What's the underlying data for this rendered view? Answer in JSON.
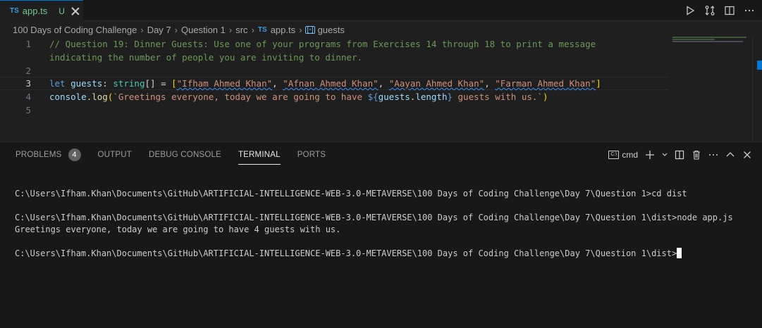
{
  "tab": {
    "lang": "TS",
    "filename": "app.ts",
    "status": "U"
  },
  "breadcrumb": {
    "items": [
      "100 Days of Coding Challenge",
      "Day 7",
      "Question 1",
      "src"
    ],
    "file_lang": "TS",
    "file": "app.ts",
    "symbol": "guests"
  },
  "editor": {
    "line_numbers": [
      "1",
      "2",
      "3",
      "4",
      "5"
    ],
    "line1a": "// Question 19: Dinner Guests: Use one of your programs from Exercises 14 through 18 to print a message",
    "line1b": "indicating the number of people you are inviting to dinner.",
    "line3": {
      "kw": "let",
      "var": "guests",
      "colon": ": ",
      "type": "string",
      "arr": "[]",
      "eq": " = ",
      "open": "[",
      "s1": "\"Ifham Ahmed Khan\"",
      "s2": "\"Afnan Ahmed Khan\"",
      "s3": "\"Aayan Ahmed Khan\"",
      "s4": "\"Farman Ahmed Khan\"",
      "comma": ", ",
      "close": "]"
    },
    "line4": {
      "obj": "console",
      "dot": ".",
      "fn": "log",
      "paren_open": "(",
      "str_a": "`Greetings everyone, today we are going to have ",
      "interp_open": "${",
      "interp_var": "guests",
      "interp_dot": ".",
      "interp_prop": "length",
      "interp_close": "}",
      "str_b": " guests with us.`",
      "paren_close": ")"
    }
  },
  "panel": {
    "tabs": [
      "PROBLEMS",
      "OUTPUT",
      "DEBUG CONSOLE",
      "TERMINAL",
      "PORTS"
    ],
    "problems_count": "4",
    "active_tab": "TERMINAL",
    "shell_icon": "C:\\",
    "shell": "cmd"
  },
  "terminal": {
    "line1": "C:\\Users\\Ifham.Khan\\Documents\\GitHub\\ARTIFICIAL-INTELLIGENCE-WEB-3.0-METAVERSE\\100 Days of Coding Challenge\\Day 7\\Question 1>cd dist",
    "line2": "C:\\Users\\Ifham.Khan\\Documents\\GitHub\\ARTIFICIAL-INTELLIGENCE-WEB-3.0-METAVERSE\\100 Days of Coding Challenge\\Day 7\\Question 1\\dist>node app.js",
    "line3": "Greetings everyone, today we are going to have 4 guests with us.",
    "line4": "C:\\Users\\Ifham.Khan\\Documents\\GitHub\\ARTIFICIAL-INTELLIGENCE-WEB-3.0-METAVERSE\\100 Days of Coding Challenge\\Day 7\\Question 1\\dist>"
  },
  "icons": {
    "run": "play-icon",
    "compare": "compare-changes-icon",
    "split": "split-editor-icon",
    "more": "more-icon"
  },
  "colors": {
    "accent": "#0078d4",
    "untracked": "#73c991",
    "comment": "#6a9955",
    "string": "#ce9178",
    "keyword": "#569cd6"
  }
}
